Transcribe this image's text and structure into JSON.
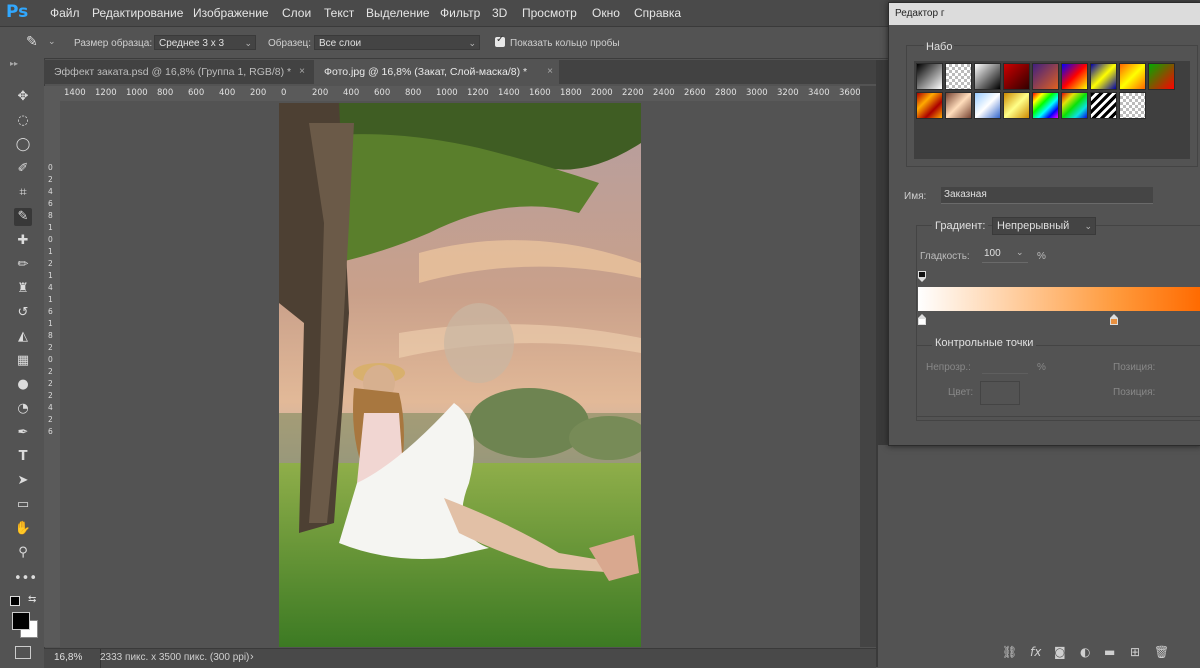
{
  "app": {
    "logo": "Ps"
  },
  "menu": [
    "Файл",
    "Редактирование",
    "Изображение",
    "Слои",
    "Текст",
    "Выделение",
    "Фильтр",
    "3D",
    "Просмотр",
    "Окно",
    "Справка"
  ],
  "options": {
    "sample_size_label": "Размер образца:",
    "sample_size_value": "Среднее 3 x 3",
    "sample_label": "Образец:",
    "sample_value": "Все слои",
    "show_ring_label": "Показать кольцо пробы"
  },
  "tabs": [
    {
      "label": "Эффект заката.psd @ 16,8% (Группа 1, RGB/8) *",
      "close": "×"
    },
    {
      "label": "Фото.jpg @ 16,8% (Закат, Слой-маска/8) *",
      "close": "×"
    }
  ],
  "ruler": {
    "horizontal": [
      "1400",
      "1200",
      "1000",
      "800",
      "600",
      "400",
      "200",
      "0",
      "200",
      "400",
      "600",
      "800",
      "1000",
      "1200",
      "1400",
      "1600",
      "1800",
      "2000",
      "2200",
      "2400",
      "2600",
      "2800",
      "3000",
      "3200",
      "3400",
      "3600"
    ],
    "vertical": [
      "0",
      "2",
      "4",
      "6",
      "8",
      "1",
      "0",
      "1",
      "2",
      "1",
      "4",
      "1",
      "6",
      "1",
      "8",
      "2",
      "0",
      "2",
      "2",
      "2",
      "4",
      "2",
      "6"
    ]
  },
  "status": {
    "zoom": "16,8%",
    "doc_info": "2333 пикс. x 3500 пикс. (300 ppi)",
    "arrow": "›"
  },
  "dialog": {
    "title": "Редактор г",
    "presets_label": "Набо",
    "name_label": "Имя:",
    "name_value": "Заказная",
    "gradient_type_label": "Градиент:",
    "gradient_type_value": "Непрерывный",
    "smoothness_label": "Гладкость:",
    "smoothness_value": "100",
    "smoothness_unit": "%",
    "color_stops_label": "Контрольные точки",
    "opacity_label": "Непрозр.:",
    "opacity_unit": "%",
    "position_label_1": "Позиция:",
    "color_label": "Цвет:",
    "position_label_2": "Позиция:",
    "gradient_start": "#ffffff",
    "gradient_mid": "#ff9a3c",
    "gradient_end": "#ff6a00",
    "stop_color": "#e89040"
  }
}
